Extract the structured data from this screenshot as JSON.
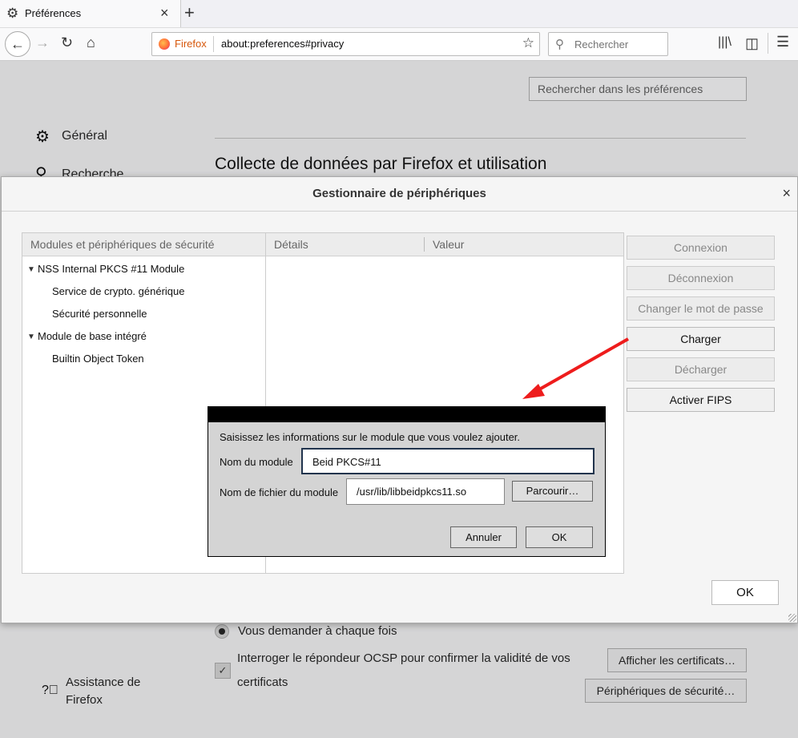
{
  "browser": {
    "tab_title": "Préférences",
    "tab_close": "×",
    "new_tab": "+",
    "brand": "Firefox",
    "url": "about:preferences#privacy",
    "search_placeholder": "Rechercher"
  },
  "prefs": {
    "search_placeholder": "Rechercher dans les préférences",
    "categories": [
      "Général",
      "Recherche"
    ],
    "section_title": "Collecte de données par Firefox et utilisation",
    "ask_every_time": "Vous demander à chaque fois",
    "ocsp_line1": "Interroger le répondeur OCSP pour confirmer la validité de vos",
    "ocsp_line2": "certificats",
    "view_certs": "Afficher les certificats…",
    "security_devices": "Périphériques de sécurité…",
    "support_line1": "Assistance de",
    "support_line2": "Firefox"
  },
  "device_manager": {
    "title": "Gestionnaire de périphériques",
    "close": "×",
    "tree_header": "Modules et périphériques de sécurité",
    "tree": [
      {
        "label": "NSS Internal PKCS #11 Module",
        "level": 0
      },
      {
        "label": "Service de crypto. générique",
        "level": 1
      },
      {
        "label": "Sécurité personnelle",
        "level": 1
      },
      {
        "label": "Module de base intégré",
        "level": 0
      },
      {
        "label": "Builtin Object Token",
        "level": 1
      }
    ],
    "details_header": "Détails",
    "value_header": "Valeur",
    "buttons": [
      {
        "label": "Connexion",
        "enabled": false
      },
      {
        "label": "Déconnexion",
        "enabled": false
      },
      {
        "label": "Changer le mot de passe",
        "enabled": false
      },
      {
        "label": "Charger",
        "enabled": true
      },
      {
        "label": "Décharger",
        "enabled": false
      },
      {
        "label": "Activer FIPS",
        "enabled": true
      }
    ],
    "ok": "OK"
  },
  "load_module": {
    "message": "Saisissez les informations sur le module que vous voulez ajouter.",
    "name_label": "Nom du module",
    "name_value": "Beid PKCS#11",
    "file_label": "Nom de fichier du module",
    "file_value": "/usr/lib/libbeidpkcs11.so",
    "browse": "Parcourir…",
    "cancel": "Annuler",
    "ok": "OK"
  },
  "colors": {
    "annotation_arrow": "#ee1c1c",
    "firefox_orange": "#d7570b"
  }
}
